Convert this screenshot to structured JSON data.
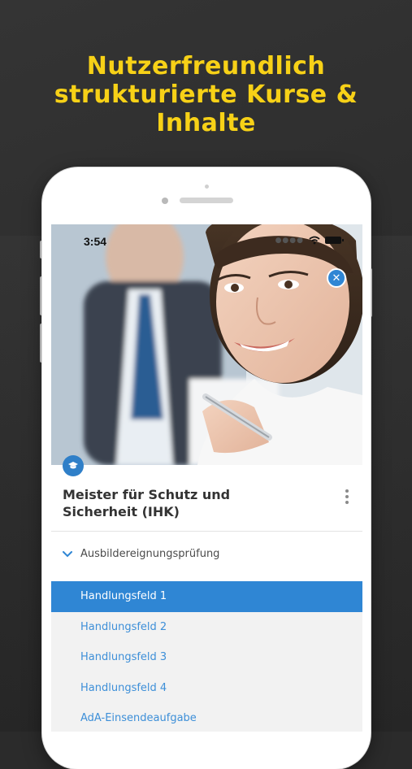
{
  "headline": {
    "line1": "Nutzerfreundlich",
    "line2": "strukturierte Kurse &",
    "line3": "Inhalte"
  },
  "colors": {
    "accent_yellow": "#f7d117",
    "primary_blue": "#2f86d4",
    "background": "#2b2b2b"
  },
  "status_bar": {
    "time": "3:54",
    "icons": [
      "signal-dots-icon",
      "wifi-icon",
      "battery-icon"
    ]
  },
  "hero": {
    "close_icon": "close-icon",
    "badge_icon": "graduation-cap-icon"
  },
  "course": {
    "title_line1": "Meister für Schutz und",
    "title_line2": "Sicherheit (IHK)",
    "menu_icon": "more-vertical-icon"
  },
  "section": {
    "label": "Ausbildereignungsprüfung",
    "expanded": true
  },
  "items": [
    {
      "label": "Handlungsfeld 1",
      "active": true
    },
    {
      "label": "Handlungsfeld 2",
      "active": false
    },
    {
      "label": "Handlungsfeld 3",
      "active": false
    },
    {
      "label": "Handlungsfeld 4",
      "active": false
    },
    {
      "label": "AdA-Einsendeaufgabe",
      "active": false
    }
  ]
}
